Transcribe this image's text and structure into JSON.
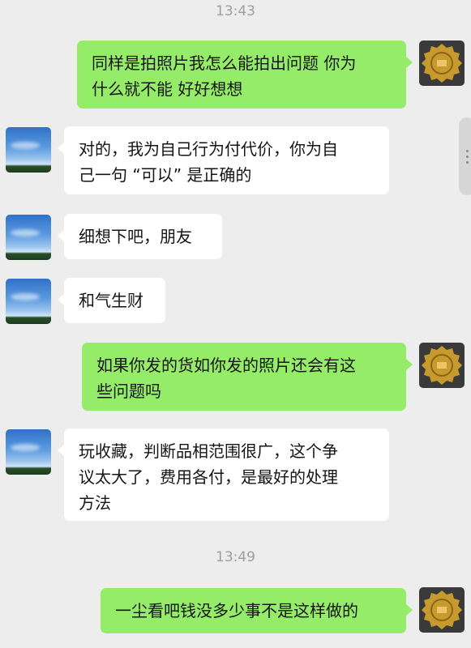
{
  "timestamps": [
    "13:43",
    "13:49"
  ],
  "messages": [
    {
      "side": "out",
      "text": "同样是拍照片我怎么能拍出问题 你为\n什么就不能 好好想想"
    },
    {
      "side": "in",
      "text": "对的，我为自己行为付代价，你为自\n己一句 “可以” 是正确的"
    },
    {
      "side": "in",
      "text": "细想下吧，朋友"
    },
    {
      "side": "in",
      "text": "和气生财"
    },
    {
      "side": "out",
      "text": "如果你发的货如你发的照片还会有这\n些问题吗"
    },
    {
      "side": "in",
      "text": "玩收藏，判断品相范围很广，这个争\n议太大了，费用各付，是最好的处理\n方法"
    },
    {
      "side": "out",
      "text": "一尘看吧钱没多少事不是这样做的"
    }
  ],
  "avatars": {
    "self": "coin-avatar-icon",
    "contact": "sky-avatar-icon"
  },
  "colors": {
    "background": "#ededed",
    "bubble_in": "#ffffff",
    "bubble_out": "#95ec69",
    "time": "#9e9e9e"
  }
}
